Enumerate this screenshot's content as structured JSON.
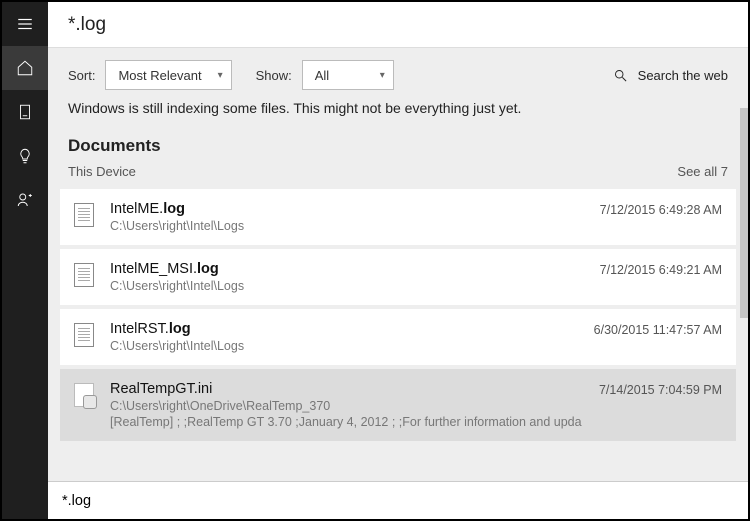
{
  "title": "*.log",
  "filters": {
    "sort_label": "Sort:",
    "sort_value": "Most Relevant",
    "show_label": "Show:",
    "show_value": "All",
    "search_web": "Search the web"
  },
  "indexing_message": "Windows is still indexing some files. This might not be everything just yet.",
  "section": {
    "title": "Documents",
    "scope": "This Device",
    "see_all": "See all 7"
  },
  "results": [
    {
      "name_pre": "IntelME.",
      "name_bold": "log",
      "path": "C:\\Users\\right\\Intel\\Logs",
      "time": "7/12/2015 6:49:28 AM"
    },
    {
      "name_pre": "IntelME_MSI.",
      "name_bold": "log",
      "path": "C:\\Users\\right\\Intel\\Logs",
      "time": "7/12/2015 6:49:21 AM"
    },
    {
      "name_pre": "IntelRST.",
      "name_bold": "log",
      "path": "C:\\Users\\right\\Intel\\Logs",
      "time": "6/30/2015 11:47:57 AM"
    },
    {
      "name_pre": "RealTempGT.ini",
      "name_bold": "",
      "path": "C:\\Users\\right\\OneDrive\\RealTemp_370",
      "extra": "[RealTemp] ; ;RealTemp GT 3.70 ;January 4, 2012 ; ;For further information and upda",
      "time": "7/14/2015 7:04:59 PM"
    }
  ],
  "search_input": "*.log"
}
